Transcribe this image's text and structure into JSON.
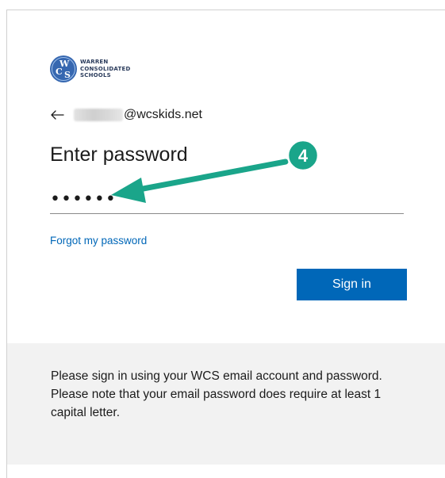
{
  "logo": {
    "line1": "WARREN",
    "line2": "CONSOLIDATED",
    "line3": "SCHOOLS",
    "seal_letters": "WCS"
  },
  "identity": {
    "email_domain": "@wcskids.net"
  },
  "title": "Enter password",
  "password": {
    "masked_value": "••••••"
  },
  "forgot_link": "Forgot my password",
  "signin_label": "Sign in",
  "info": "Please sign in using your WCS email account and password. Please note that your email password does require at least 1 capital letter.",
  "annotation": {
    "step_number": "4"
  },
  "colors": {
    "accent": "#0067b8",
    "annotation_green": "#1aa58a",
    "panel_bg": "#f2f2f2"
  },
  "icons": {
    "back": "back-arrow-icon",
    "logo": "wcs-seal-logo"
  }
}
